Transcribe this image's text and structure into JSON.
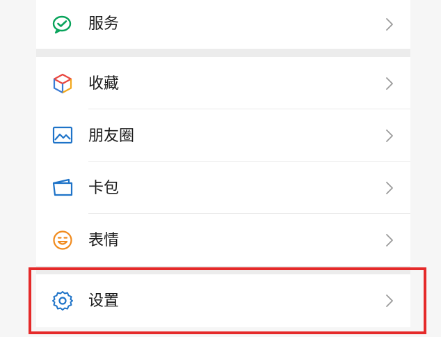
{
  "menu": {
    "services": {
      "label": "服务",
      "icon": "wechat-pay-icon",
      "color": "#07a35a"
    },
    "favorites": {
      "label": "收藏",
      "icon": "cube-icon"
    },
    "moments": {
      "label": "朋友圈",
      "icon": "image-icon",
      "color": "#1e73c8"
    },
    "cards": {
      "label": "卡包",
      "icon": "wallet-icon",
      "color": "#1e73c8"
    },
    "stickers": {
      "label": "表情",
      "icon": "smiley-icon",
      "color": "#f08a1c"
    },
    "settings": {
      "label": "设置",
      "icon": "gear-icon",
      "color": "#1e73c8"
    }
  },
  "highlight": {
    "color": "#e52a2a"
  }
}
